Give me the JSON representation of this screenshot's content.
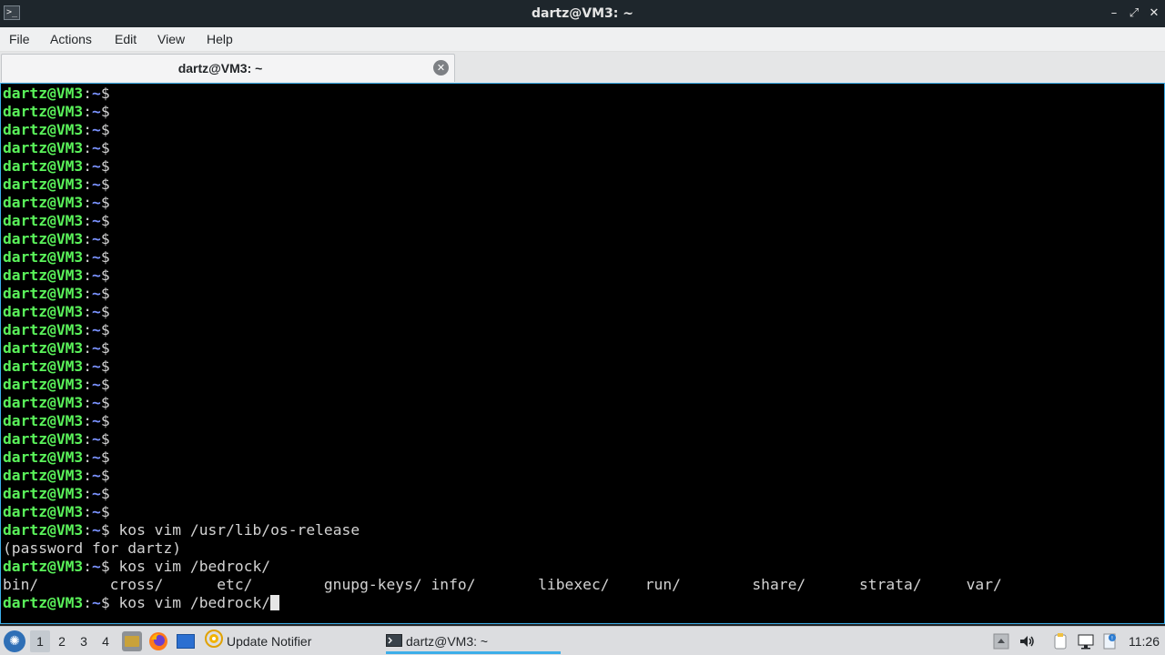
{
  "window": {
    "title": "dartz@VM3: ~",
    "app_icon": "terminal-icon",
    "controls": {
      "minimize": "–",
      "restore": "⤢",
      "close": "✕"
    }
  },
  "menubar": {
    "items": [
      "File",
      "Actions",
      "Edit",
      "View",
      "Help"
    ]
  },
  "tabs": [
    {
      "label": "dartz@VM3: ~",
      "close_icon": "close-circle-icon"
    }
  ],
  "terminal": {
    "prompt_user": "dartz@VM3",
    "prompt_sep": ":",
    "prompt_path": "~",
    "prompt_symbol": "$",
    "empty_prompt_count": 24,
    "lines_after": [
      {
        "type": "prompt",
        "cmd": " kos vim /usr/lib/os-release"
      },
      {
        "type": "output",
        "text": "(password for dartz)"
      },
      {
        "type": "prompt",
        "cmd": " kos vim /bedrock/"
      },
      {
        "type": "output",
        "text": "bin/        cross/      etc/        gnupg-keys/ info/       libexec/    run/        share/      strata/     var/"
      },
      {
        "type": "prompt",
        "cmd": " kos vim /bedrock/",
        "cursor": true
      }
    ]
  },
  "taskbar": {
    "start_icon": "start-menu-icon",
    "desktops": [
      "1",
      "2",
      "3",
      "4"
    ],
    "active_desktop": "1",
    "quicklaunch": [
      "file-manager-icon",
      "firefox-icon",
      "show-desktop-icon"
    ],
    "tasks": [
      {
        "label": "Update Notifier",
        "icon": "update-notifier-icon"
      },
      {
        "label": "dartz@VM3: ~",
        "icon": "terminal-icon",
        "active": true
      }
    ],
    "tray": [
      "tray-arrow-icon",
      "volume-icon",
      "clipboard-icon",
      "network-icon",
      "updates-icon"
    ],
    "clock": "11:26"
  },
  "colors": {
    "accent": "#3daee9",
    "prompt_green": "#5af25a",
    "prompt_path_blue": "#7b93ff",
    "terminal_bg": "#000000",
    "titlebar_bg": "#1e262c"
  }
}
